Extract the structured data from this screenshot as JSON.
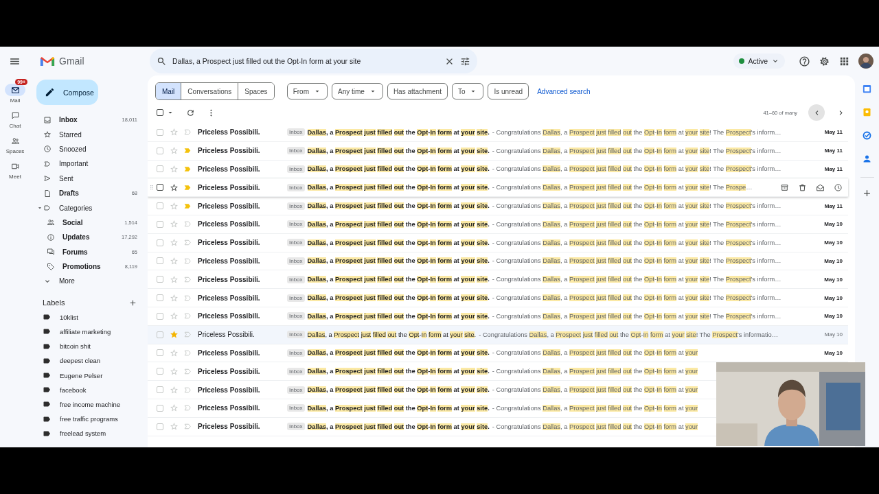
{
  "header": {
    "app_name": "Gmail",
    "search": {
      "value": "Dallas, a Prospect just filled out the Opt-In form at your site"
    },
    "status": {
      "label": "Active",
      "online": true
    }
  },
  "rail": [
    {
      "label": "Mail",
      "selected": true,
      "badge": "99+"
    },
    {
      "label": "Chat",
      "selected": false
    },
    {
      "label": "Spaces",
      "selected": false
    },
    {
      "label": "Meet",
      "selected": false
    }
  ],
  "compose": "Compose",
  "nav": [
    {
      "kind": "item",
      "label": "Inbox",
      "count": "18,011",
      "bold": true
    },
    {
      "kind": "item",
      "label": "Starred",
      "bold": false
    },
    {
      "kind": "item",
      "label": "Snoozed",
      "bold": false
    },
    {
      "kind": "item",
      "label": "Important",
      "bold": false
    },
    {
      "kind": "item",
      "label": "Sent",
      "bold": false
    },
    {
      "kind": "item",
      "label": "Drafts",
      "count": "68",
      "bold": true
    },
    {
      "kind": "group",
      "label": "Categories",
      "bold": false,
      "expanded": true
    },
    {
      "kind": "sub",
      "label": "Social",
      "count": "1,514",
      "bold": true
    },
    {
      "kind": "sub",
      "label": "Updates",
      "count": "17,292",
      "bold": true
    },
    {
      "kind": "sub",
      "label": "Forums",
      "count": "65",
      "bold": true
    },
    {
      "kind": "sub",
      "label": "Promotions",
      "count": "8,119",
      "bold": true
    },
    {
      "kind": "more",
      "label": "More",
      "bold": false
    }
  ],
  "labels": {
    "title": "Labels",
    "items": [
      "10klist",
      "affiliate marketing",
      "bitcoin shit",
      "deepest clean",
      "Eugene Pelser",
      "facebook",
      "free income machine",
      "free traffic programs",
      "freelead system"
    ]
  },
  "scope_tabs": [
    {
      "label": "Mail",
      "selected": true
    },
    {
      "label": "Conversations",
      "selected": false
    },
    {
      "label": "Spaces",
      "selected": false
    }
  ],
  "filters": [
    {
      "label": "From",
      "dropdown": true
    },
    {
      "label": "Any time",
      "dropdown": true
    },
    {
      "label": "Has attachment",
      "dropdown": false
    },
    {
      "label": "To",
      "dropdown": true
    },
    {
      "label": "Is unread",
      "dropdown": false
    }
  ],
  "advanced_search": "Advanced search",
  "toolbar": {
    "select_all_checked": false
  },
  "pagination": "41–60 of many",
  "rows": [
    {
      "sender": "Priceless Possibili.",
      "checked": false,
      "read": false,
      "starred": false,
      "important": false,
      "hovered": false,
      "tag": "Inbox",
      "subject": [
        "Dallas",
        ", a ",
        "Prospect just filled out",
        " the ",
        "Opt",
        "-",
        "In form",
        " at ",
        "your site",
        "."
      ],
      "snippet": [
        "- Congratulations ",
        "Dallas",
        ", a ",
        "Prospect just filled out",
        " the ",
        "Opt",
        "-",
        "In form",
        " at ",
        "your site",
        "! The ",
        "Prospect",
        "'s inform…"
      ],
      "date": "May 11"
    },
    {
      "sender": "Priceless Possibili.",
      "checked": false,
      "read": false,
      "starred": false,
      "important": true,
      "hovered": false,
      "tag": "Inbox",
      "subject": [
        "Dallas",
        ", a ",
        "Prospect just filled out",
        " the ",
        "Opt",
        "-",
        "In form",
        " at ",
        "your site",
        "."
      ],
      "snippet": [
        "- Congratulations ",
        "Dallas",
        ", a ",
        "Prospect just filled out",
        " the ",
        "Opt",
        "-",
        "In form",
        " at ",
        "your site",
        "! The ",
        "Prospect",
        "'s inform…"
      ],
      "date": "May 11"
    },
    {
      "sender": "Priceless Possibili.",
      "checked": false,
      "read": false,
      "starred": false,
      "important": true,
      "hovered": false,
      "tag": "Inbox",
      "subject": [
        "Dallas",
        ", a ",
        "Prospect just filled out",
        " the ",
        "Opt",
        "-",
        "In form",
        " at ",
        "your site",
        "."
      ],
      "snippet": [
        "- Congratulations ",
        "Dallas",
        ", a ",
        "Prospect just filled out",
        " the ",
        "Opt",
        "-",
        "In form",
        " at ",
        "your site",
        "! The ",
        "Prospect",
        "'s inform…"
      ],
      "date": "May 11"
    },
    {
      "sender": "Priceless Possibili.",
      "checked": false,
      "read": false,
      "starred": false,
      "important": true,
      "hovered": true,
      "tag": "Inbox",
      "subject": [
        "Dallas",
        ", a ",
        "Prospect just filled out",
        " the ",
        "Opt",
        "-",
        "In form",
        " at ",
        "your site",
        "."
      ],
      "snippet": [
        "- Congratulations ",
        "Dallas",
        ", a ",
        "Prospect just filled out",
        " the ",
        "Opt",
        "-",
        "In form",
        " at ",
        "your site",
        "! The ",
        "Prospe",
        "…"
      ]
    },
    {
      "sender": "Priceless Possibili.",
      "checked": false,
      "read": false,
      "starred": false,
      "important": true,
      "hovered": false,
      "tag": "Inbox",
      "subject": [
        "Dallas",
        ", a ",
        "Prospect just filled out",
        " the ",
        "Opt",
        "-",
        "In form",
        " at ",
        "your site",
        "."
      ],
      "snippet": [
        "- Congratulations ",
        "Dallas",
        ", a ",
        "Prospect just filled out",
        " the ",
        "Opt",
        "-",
        "In form",
        " at ",
        "your site",
        "! The ",
        "Prospect",
        "'s inform…"
      ],
      "date": "May 11"
    },
    {
      "sender": "Priceless Possibili.",
      "checked": false,
      "read": false,
      "starred": false,
      "important": false,
      "hovered": false,
      "tag": "Inbox",
      "subject": [
        "Dallas",
        ", a ",
        "Prospect just filled out",
        " the ",
        "Opt",
        "-",
        "In form",
        " at ",
        "your site",
        "."
      ],
      "snippet": [
        "- Congratulations ",
        "Dallas",
        ", a ",
        "Prospect just filled out",
        " the ",
        "Opt",
        "-",
        "In form",
        " at ",
        "your site",
        "! The ",
        "Prospect",
        "'s inform…"
      ],
      "date": "May 10"
    },
    {
      "sender": "Priceless Possibili.",
      "checked": false,
      "read": false,
      "starred": false,
      "important": false,
      "hovered": false,
      "tag": "Inbox",
      "subject": [
        "Dallas",
        ", a ",
        "Prospect just filled out",
        " the ",
        "Opt",
        "-",
        "In form",
        " at ",
        "your site",
        "."
      ],
      "snippet": [
        "- Congratulations ",
        "Dallas",
        ", a ",
        "Prospect just filled out",
        " the ",
        "Opt",
        "-",
        "In form",
        " at ",
        "your site",
        "! The ",
        "Prospect",
        "'s inform…"
      ],
      "date": "May 10"
    },
    {
      "sender": "Priceless Possibili.",
      "checked": false,
      "read": false,
      "starred": false,
      "important": false,
      "hovered": false,
      "tag": "Inbox",
      "subject": [
        "Dallas",
        ", a ",
        "Prospect just filled out",
        " the ",
        "Opt",
        "-",
        "In form",
        " at ",
        "your site",
        "."
      ],
      "snippet": [
        "- Congratulations ",
        "Dallas",
        ", a ",
        "Prospect just filled out",
        " the ",
        "Opt",
        "-",
        "In form",
        " at ",
        "your site",
        "! The ",
        "Prospect",
        "'s inform…"
      ],
      "date": "May 10"
    },
    {
      "sender": "Priceless Possibili.",
      "checked": false,
      "read": false,
      "starred": false,
      "important": false,
      "hovered": false,
      "tag": "Inbox",
      "subject": [
        "Dallas",
        ", a ",
        "Prospect just filled out",
        " the ",
        "Opt",
        "-",
        "In form",
        " at ",
        "your site",
        "."
      ],
      "snippet": [
        "- Congratulations ",
        "Dallas",
        ", a ",
        "Prospect just filled out",
        " the ",
        "Opt",
        "-",
        "In form",
        " at ",
        "your site",
        "! The ",
        "Prospect",
        "'s inform…"
      ],
      "date": "May 10"
    },
    {
      "sender": "Priceless Possibili.",
      "checked": false,
      "read": false,
      "starred": false,
      "important": false,
      "hovered": false,
      "tag": "Inbox",
      "subject": [
        "Dallas",
        ", a ",
        "Prospect just filled out",
        " the ",
        "Opt",
        "-",
        "In form",
        " at ",
        "your site",
        "."
      ],
      "snippet": [
        "- Congratulations ",
        "Dallas",
        ", a ",
        "Prospect just filled out",
        " the ",
        "Opt",
        "-",
        "In form",
        " at ",
        "your site",
        "! The ",
        "Prospect",
        "'s inform…"
      ],
      "date": "May 10"
    },
    {
      "sender": "Priceless Possibili.",
      "checked": false,
      "read": false,
      "starred": false,
      "important": false,
      "hovered": false,
      "tag": "Inbox",
      "subject": [
        "Dallas",
        ", a ",
        "Prospect just filled out",
        " the ",
        "Opt",
        "-",
        "In form",
        " at ",
        "your site",
        "."
      ],
      "snippet": [
        "- Congratulations ",
        "Dallas",
        ", a ",
        "Prospect just filled out",
        " the ",
        "Opt",
        "-",
        "In form",
        " at ",
        "your site",
        "! The ",
        "Prospect",
        "'s inform…"
      ],
      "date": "May 10"
    },
    {
      "sender": "Priceless Possibili.",
      "checked": false,
      "read": true,
      "starred": true,
      "important": false,
      "hovered": false,
      "tag": "Inbox",
      "subject": [
        "Dallas",
        ", a ",
        "Prospect just filled out",
        " the ",
        "Opt",
        "-",
        "In form",
        " at ",
        "your site",
        "."
      ],
      "snippet": [
        "- Congratulations ",
        "Dallas",
        ", a ",
        "Prospect just filled out",
        " the ",
        "Opt",
        "-",
        "In form",
        " at ",
        "your site",
        "! The ",
        "Prospect",
        "'s informatio…"
      ],
      "date": "May 10"
    },
    {
      "sender": "Priceless Possibili.",
      "checked": false,
      "read": false,
      "starred": false,
      "important": false,
      "hovered": false,
      "tag": "Inbox",
      "subject": [
        "Dallas",
        ", a ",
        "Prospect just filled out",
        " the ",
        "Opt",
        "-",
        "In form",
        " at ",
        "your site",
        "."
      ],
      "snippet": [
        "- Congratulations ",
        "Dallas",
        ", a ",
        "Prospect just filled out",
        " the ",
        "Opt",
        "-",
        "In form",
        " at ",
        "your"
      ],
      "date": "May 10"
    },
    {
      "sender": "Priceless Possibili.",
      "checked": false,
      "read": false,
      "starred": false,
      "important": false,
      "hovered": false,
      "tag": "Inbox",
      "subject": [
        "Dallas",
        ", a ",
        "Prospect just filled out",
        " the ",
        "Opt",
        "-",
        "In form",
        " at ",
        "your site",
        "."
      ],
      "snippet": [
        "- Congratulations ",
        "Dallas",
        ", a ",
        "Prospect just filled out",
        " the ",
        "Opt",
        "-",
        "In form",
        " at ",
        "your"
      ]
    },
    {
      "sender": "Priceless Possibili.",
      "checked": false,
      "read": false,
      "starred": false,
      "important": false,
      "hovered": false,
      "tag": "Inbox",
      "subject": [
        "Dallas",
        ", a ",
        "Prospect just filled out",
        " the ",
        "Opt",
        "-",
        "In form",
        " at ",
        "your site",
        "."
      ],
      "snippet": [
        "- Congratulations ",
        "Dallas",
        ", a ",
        "Prospect just filled out",
        " the ",
        "Opt",
        "-",
        "In form",
        " at ",
        "your"
      ]
    },
    {
      "sender": "Priceless Possibili.",
      "checked": false,
      "read": false,
      "starred": false,
      "important": false,
      "hovered": false,
      "tag": "Inbox",
      "subject": [
        "Dallas",
        ", a ",
        "Prospect just filled out",
        " the ",
        "Opt",
        "-",
        "In form",
        " at ",
        "your site",
        "."
      ],
      "snippet": [
        "- Congratulations ",
        "Dallas",
        ", a ",
        "Prospect just filled out",
        " the ",
        "Opt",
        "-",
        "In form",
        " at ",
        "your"
      ]
    },
    {
      "sender": "Priceless Possibili.",
      "checked": false,
      "read": false,
      "starred": false,
      "important": false,
      "hovered": false,
      "tag": "Inbox",
      "subject": [
        "Dallas",
        ", a ",
        "Prospect just filled out",
        " the ",
        "Opt",
        "-",
        "In form",
        " at ",
        "your site",
        "."
      ],
      "snippet": [
        "- Congratulations ",
        "Dallas",
        ", a ",
        "Prospect just filled out",
        " the ",
        "Opt",
        "-",
        "In form",
        " at ",
        "your"
      ]
    }
  ]
}
